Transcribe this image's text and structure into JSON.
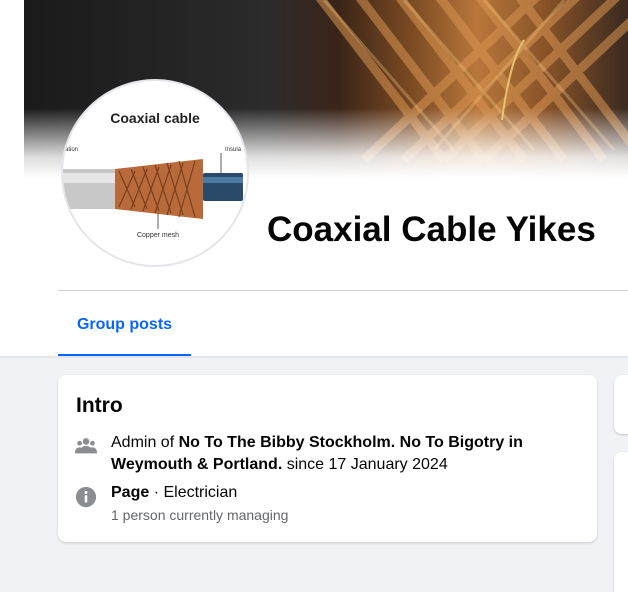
{
  "profile": {
    "name": "Coaxial Cable Yikes",
    "avatar": {
      "heading": "Coaxial cable",
      "left_label": "ation",
      "right_label": "Insula",
      "bottom_label": "Copper mesh"
    }
  },
  "tabs": [
    {
      "label": "Group posts",
      "active": true
    }
  ],
  "intro": {
    "title": "Intro",
    "admin_prefix": "Admin of ",
    "group_name": "No To The Bibby Stockholm. No To Bigotry in Weymouth & Portland.",
    "admin_suffix": " since 17 January 2024",
    "page_label": "Page",
    "page_category": " · Electrician",
    "managing": "1 person currently managing"
  },
  "icons": {
    "admin": "people-group-icon",
    "page": "info-circle-icon"
  },
  "colors": {
    "accent": "#0866ff",
    "background": "#f0f2f5",
    "text": "#050505",
    "secondary_text": "#65676b",
    "icon_gray": "#8a8d91"
  }
}
